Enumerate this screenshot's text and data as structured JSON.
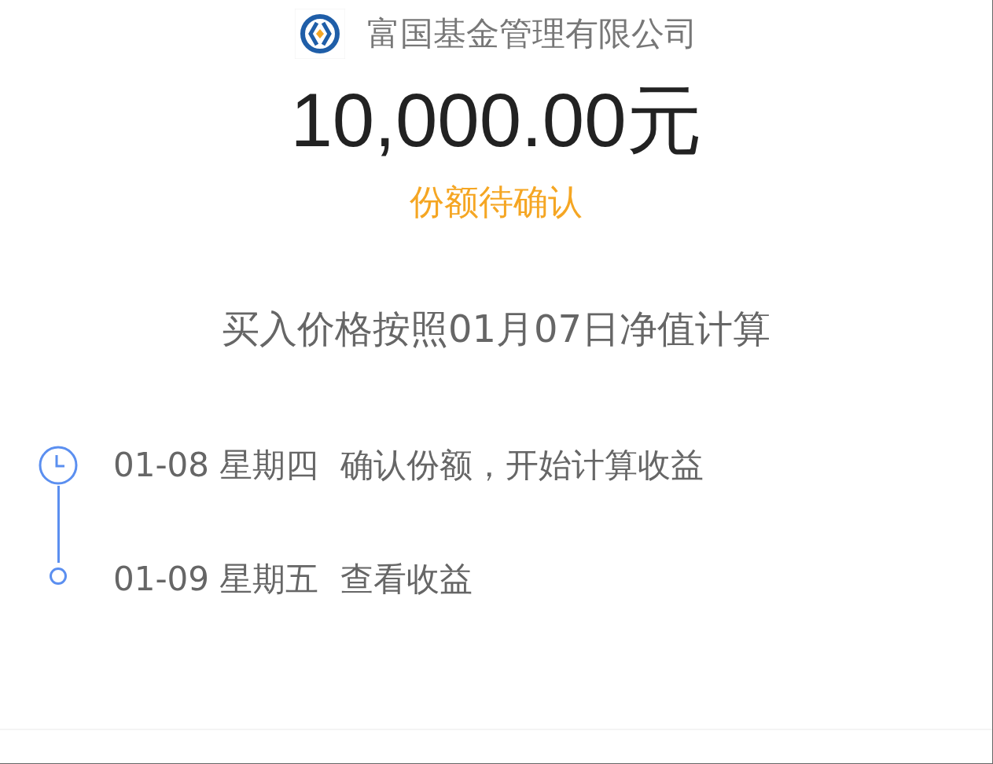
{
  "fund": {
    "company": "富国基金管理有限公司"
  },
  "amount": "10,000.00元",
  "status": "份额待确认",
  "note": "买入价格按照01月07日净值计算",
  "timeline": [
    {
      "kind": "clock",
      "date": "01-08 星期四",
      "text": "确认份额，开始计算收益"
    },
    {
      "kind": "dot",
      "date": "01-09 星期五",
      "text": "查看收益"
    }
  ]
}
